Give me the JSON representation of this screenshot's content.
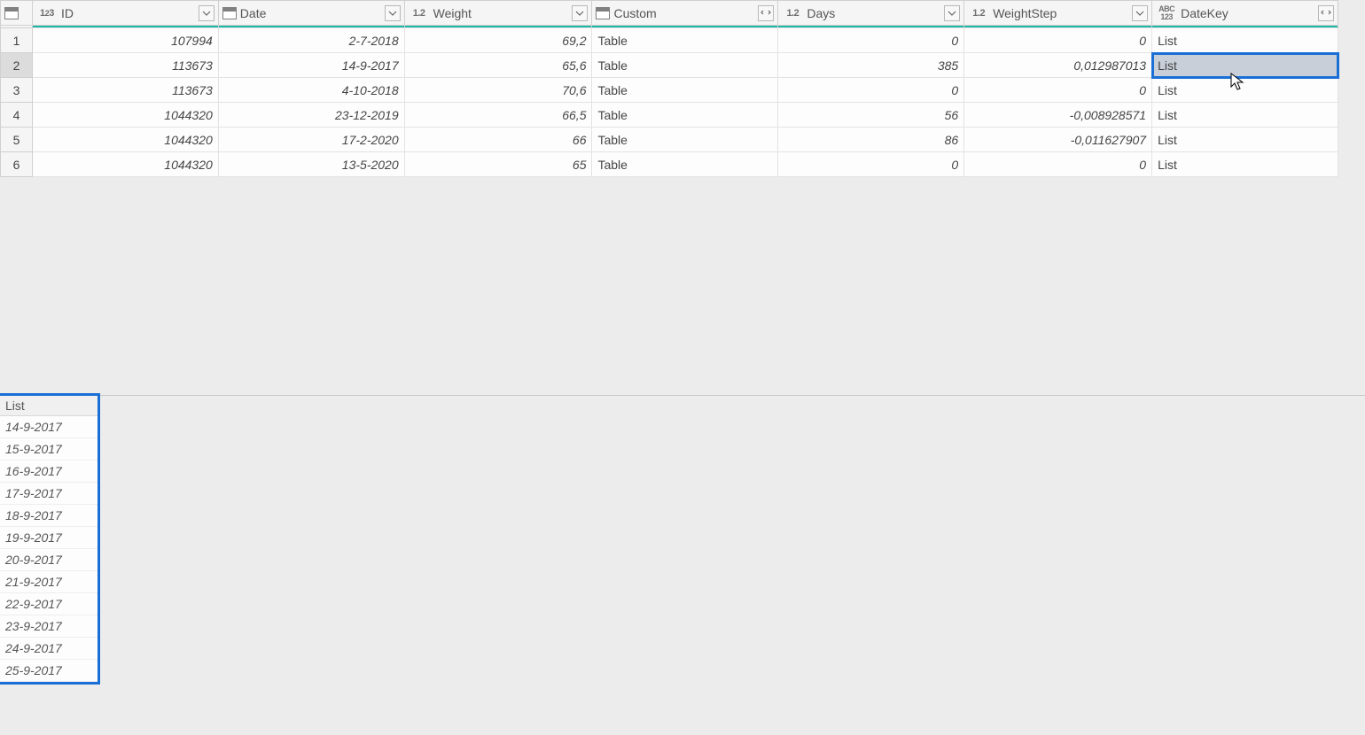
{
  "columns": {
    "id": {
      "label": "ID",
      "typeIcon": "int"
    },
    "date": {
      "label": "Date",
      "typeIcon": "cal"
    },
    "weight": {
      "label": "Weight",
      "typeIcon": "dec"
    },
    "custom": {
      "label": "Custom",
      "typeIcon": "table"
    },
    "days": {
      "label": "Days",
      "typeIcon": "dec"
    },
    "wstep": {
      "label": "WeightStep",
      "typeIcon": "dec"
    },
    "dkey": {
      "label": "DateKey",
      "typeIcon": "abc"
    }
  },
  "rows": [
    {
      "n": "1",
      "id": "107994",
      "date": "2-7-2018",
      "weight": "69,2",
      "custom": "Table",
      "days": "0",
      "wstep": "0",
      "dkey": "List"
    },
    {
      "n": "2",
      "id": "113673",
      "date": "14-9-2017",
      "weight": "65,6",
      "custom": "Table",
      "days": "385",
      "wstep": "0,012987013",
      "dkey": "List"
    },
    {
      "n": "3",
      "id": "113673",
      "date": "4-10-2018",
      "weight": "70,6",
      "custom": "Table",
      "days": "0",
      "wstep": "0",
      "dkey": "List"
    },
    {
      "n": "4",
      "id": "1044320",
      "date": "23-12-2019",
      "weight": "66,5",
      "custom": "Table",
      "days": "56",
      "wstep": "-0,008928571",
      "dkey": "List"
    },
    {
      "n": "5",
      "id": "1044320",
      "date": "17-2-2020",
      "weight": "66",
      "custom": "Table",
      "days": "86",
      "wstep": "-0,011627907",
      "dkey": "List"
    },
    {
      "n": "6",
      "id": "1044320",
      "date": "13-5-2020",
      "weight": "65",
      "custom": "Table",
      "days": "0",
      "wstep": "0",
      "dkey": "List"
    }
  ],
  "selectedRowIndex": 1,
  "selectedCell": {
    "row": 1,
    "col": "dkey"
  },
  "preview": {
    "header": "List",
    "items": [
      "14-9-2017",
      "15-9-2017",
      "16-9-2017",
      "17-9-2017",
      "18-9-2017",
      "19-9-2017",
      "20-9-2017",
      "21-9-2017",
      "22-9-2017",
      "23-9-2017",
      "24-9-2017",
      "25-9-2017"
    ]
  },
  "icons": {
    "int": "1²3",
    "dec": "1.2",
    "abc": "ABC 123"
  }
}
